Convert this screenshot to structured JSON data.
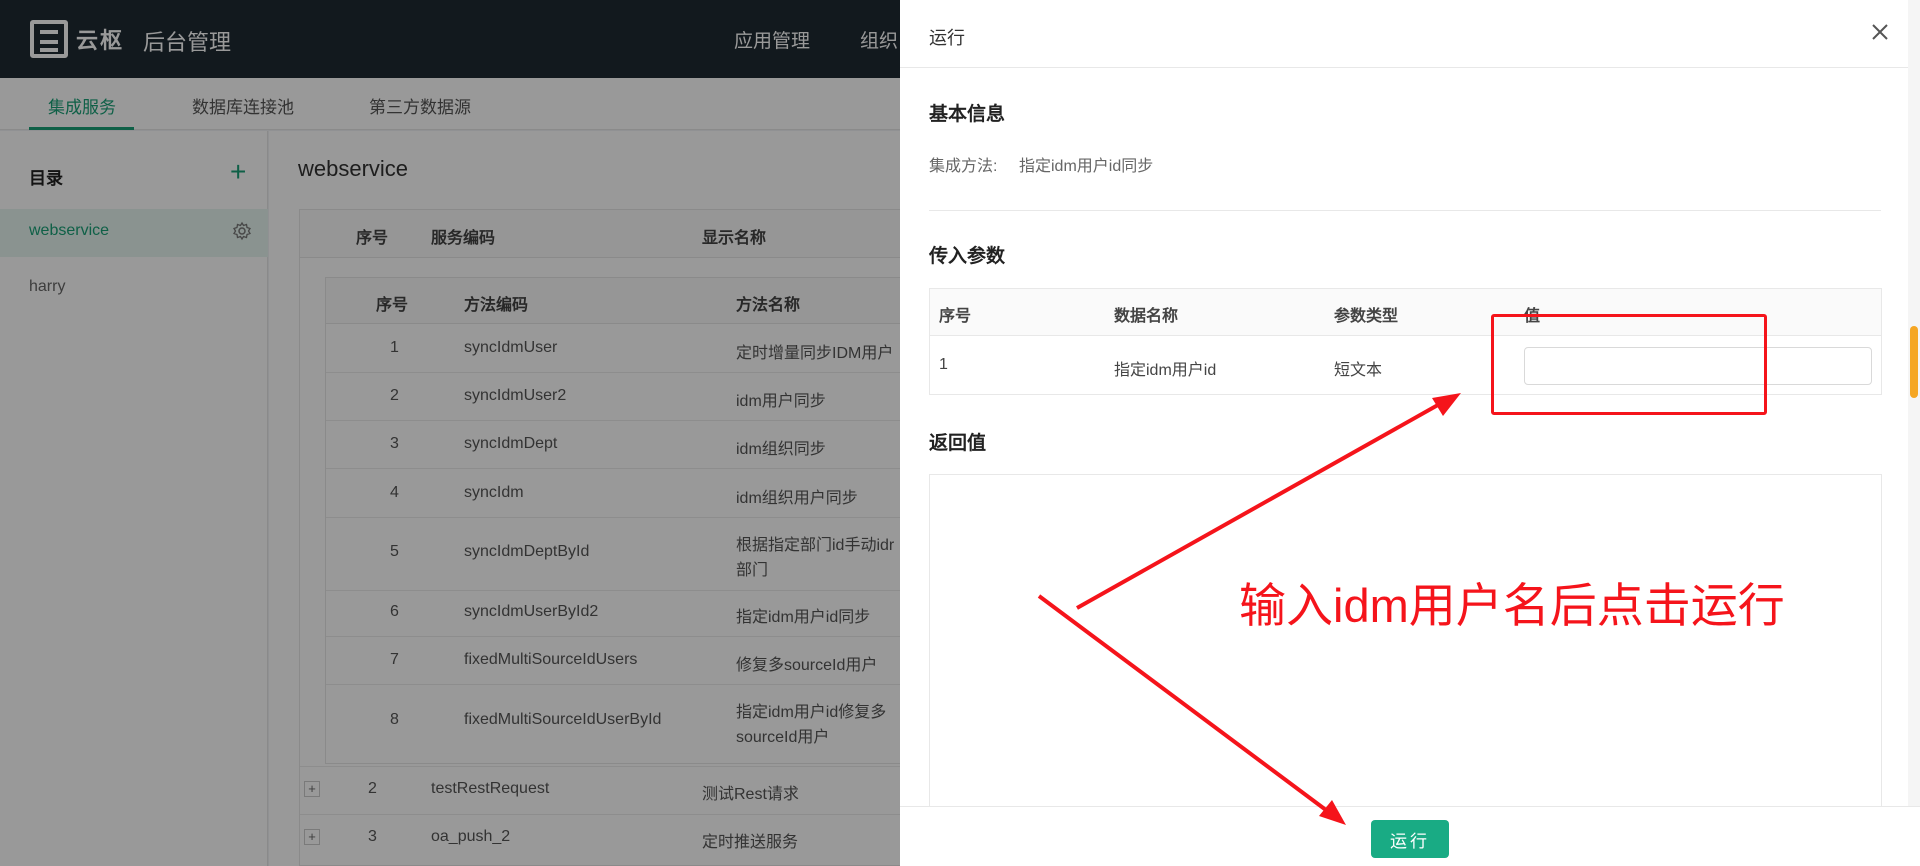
{
  "header": {
    "logo_text": "云枢",
    "app_title": "后台管理",
    "nav": [
      "应用管理",
      "组织"
    ]
  },
  "subnav": {
    "tabs": [
      "集成服务",
      "数据库连接池",
      "第三方数据源"
    ]
  },
  "sidebar": {
    "heading": "目录",
    "items": [
      "webservice",
      "harry"
    ]
  },
  "main": {
    "title": "webservice",
    "columns": [
      "序号",
      "服务编码",
      "显示名称"
    ],
    "sub_columns": [
      "序号",
      "方法编码",
      "方法名称"
    ],
    "methods": [
      {
        "no": "1",
        "code": "syncIdmUser",
        "name": "定时增量同步IDM用户"
      },
      {
        "no": "2",
        "code": "syncIdmUser2",
        "name": "idm用户同步"
      },
      {
        "no": "3",
        "code": "syncIdmDept",
        "name": "idm组织同步"
      },
      {
        "no": "4",
        "code": "syncIdm",
        "name": "idm组织用户同步"
      },
      {
        "no": "5",
        "code": "syncIdmDeptById",
        "name": "根据指定部门id手动idr",
        "name2": "部门"
      },
      {
        "no": "6",
        "code": "syncIdmUserById2",
        "name": "指定idm用户id同步"
      },
      {
        "no": "7",
        "code": "fixedMultiSourceIdUsers",
        "name": "修复多sourceId用户"
      },
      {
        "no": "8",
        "code": "fixedMultiSourceIdUserById",
        "name": "指定idm用户id修复多",
        "name2": "sourceId用户"
      }
    ],
    "services": [
      {
        "expander": "+",
        "no": "2",
        "code": "testRestRequest",
        "name": "测试Rest请求"
      },
      {
        "expander": "+",
        "no": "3",
        "code": "oa_push_2",
        "name": "定时推送服务"
      }
    ]
  },
  "drawer": {
    "title": "运行",
    "basic_info_title": "基本信息",
    "method_label": "集成方法:",
    "method_value": "指定idm用户id同步",
    "params_title": "传入参数",
    "param_columns": [
      "序号",
      "数据名称",
      "参数类型",
      "值"
    ],
    "params": [
      {
        "no": "1",
        "name": "指定idm用户id",
        "type": "短文本",
        "value": ""
      }
    ],
    "return_title": "返回值",
    "run_label": "运行"
  },
  "annotation": {
    "text": "输入idm用户名后点击运行",
    "color": "#f5141b"
  },
  "colors": {
    "accent": "#19a077",
    "button": "#19ab84",
    "topbar": "#1e2a33"
  }
}
